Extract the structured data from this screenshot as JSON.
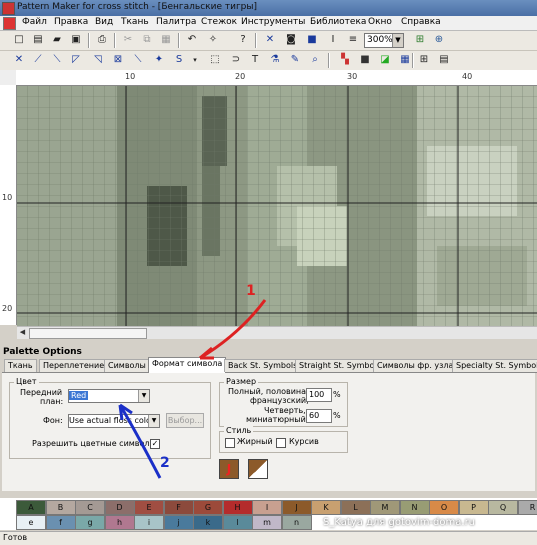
{
  "window": {
    "title": "Pattern Maker for cross stitch - [Бенгальские тигры]"
  },
  "menu": [
    "Файл",
    "Правка",
    "Вид",
    "Ткань",
    "Палитра",
    "Стежок",
    "Инструменты",
    "Библиотека",
    "Окно",
    "Справка"
  ],
  "toolbar": {
    "zoom_value": "300%"
  },
  "ruler": {
    "h_labels": [
      "10",
      "20",
      "30",
      "40"
    ],
    "v_labels": [
      "10",
      "20"
    ]
  },
  "palette_options": {
    "title": "Palette Options",
    "tabs": [
      "Ткань",
      "Переплетение",
      "Символы",
      "Формат символа",
      "Back St. Symbols",
      "Straight St. Symbols",
      "Символы фр. узла",
      "Specialty St. Symbols"
    ],
    "active_tab": "Формат символа",
    "color_group": {
      "label": "Цвет",
      "foreground_label_line1": "Передний",
      "foreground_label_line2": "план:",
      "foreground_value": "Red",
      "background_label": "Фон:",
      "background_value": "Use actual floss color",
      "choose_button": "Выбор...",
      "allow_color_symbols_label": "Разрешить цветные символы",
      "allow_color_symbols_checked": "✓"
    },
    "size_group": {
      "label": "Размер",
      "full_label_line1": "Полный, половина,",
      "full_label_line2": "французский,",
      "full_value": "100",
      "quarter_label_line1": "Четверть,",
      "quarter_label_line2": "миниатюрный,",
      "quarter_value": "60",
      "percent": "%"
    },
    "style_group": {
      "label": "Стиль",
      "bold_label": "Жирный",
      "italic_label": "Курсив"
    },
    "preview_symbol": "J"
  },
  "annotations": {
    "arrow1_label": "1",
    "arrow2_label": "2"
  },
  "swatches": {
    "row1": [
      {
        "label": "A",
        "color": "#3c5a3a"
      },
      {
        "label": "B",
        "color": "#b4a8a0"
      },
      {
        "label": "C",
        "color": "#a49a94"
      },
      {
        "label": "D",
        "color": "#8c6e6a"
      },
      {
        "label": "E",
        "color": "#a04e42"
      },
      {
        "label": "F",
        "color": "#8c4a3c"
      },
      {
        "label": "G",
        "color": "#9c4a3a"
      },
      {
        "label": "H",
        "color": "#b42c2c"
      },
      {
        "label": "I",
        "color": "#c8a090"
      },
      {
        "label": "J",
        "color": "#8c5a2a"
      },
      {
        "label": "K",
        "color": "#c8a070"
      },
      {
        "label": "L",
        "color": "#8c7058"
      },
      {
        "label": "M",
        "color": "#a09878"
      },
      {
        "label": "N",
        "color": "#989c74"
      },
      {
        "label": "O",
        "color": "#d88a48"
      },
      {
        "label": "P",
        "color": "#c8b890"
      },
      {
        "label": "Q",
        "color": "#b8b8a0"
      },
      {
        "label": "R",
        "color": "#aaa"
      }
    ],
    "row2": [
      {
        "label": "e",
        "color": "#e8f0f4"
      },
      {
        "label": "f",
        "color": "#6a90b0"
      },
      {
        "label": "g",
        "color": "#7aa8a8"
      },
      {
        "label": "h",
        "color": "#b07890"
      },
      {
        "label": "i",
        "color": "#a8c4c8"
      },
      {
        "label": "j",
        "color": "#4a7a9c"
      },
      {
        "label": "k",
        "color": "#3a6a8a"
      },
      {
        "label": "l",
        "color": "#5a8a9a"
      },
      {
        "label": "m",
        "color": "#c0b8c8"
      },
      {
        "label": "n",
        "color": "#9aa8a0"
      }
    ]
  },
  "watermark": "S_Katya для gotovim-doma.ru",
  "status": "Готов"
}
